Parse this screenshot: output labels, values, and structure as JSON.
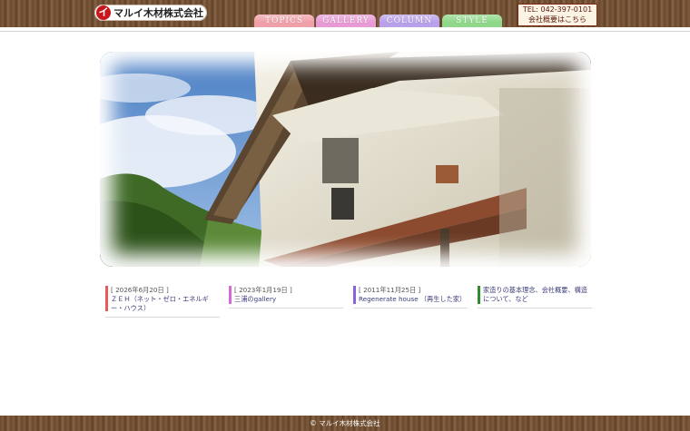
{
  "header": {
    "logo_mark": "イ",
    "logo_text": "マルイ木材株式会社",
    "nav": [
      {
        "label": "TOPICS",
        "color": "#f0a0a8"
      },
      {
        "label": "GALLERY",
        "color": "#e89ad4"
      },
      {
        "label": "COLUMN",
        "color": "#b9a0ea"
      },
      {
        "label": "STYLE",
        "color": "#8fd889"
      }
    ],
    "tel": {
      "line1": "TEL: 042-397-0101",
      "line2": "会社概要はこちら"
    }
  },
  "news": [
    {
      "date": "[ 2026年6月20日 ]",
      "title": "ＺＥＨ（ネット・ゼロ・エネルギー・ハウス）",
      "color": "#e85a5a"
    },
    {
      "date": "[ 2023年1月19日 ]",
      "title": "三浦のgallery",
      "color": "#d36ad6"
    },
    {
      "date": "[ 2011年11月25日 ]",
      "title": "Regenerate house （再生した家）",
      "color": "#8a62e0"
    },
    {
      "date": "",
      "title": "家造りの基本理念、会社概要、構造について、など",
      "color": "#2e8b2e"
    }
  ],
  "footer": {
    "copyright": "© マルイ木材株式会社"
  }
}
